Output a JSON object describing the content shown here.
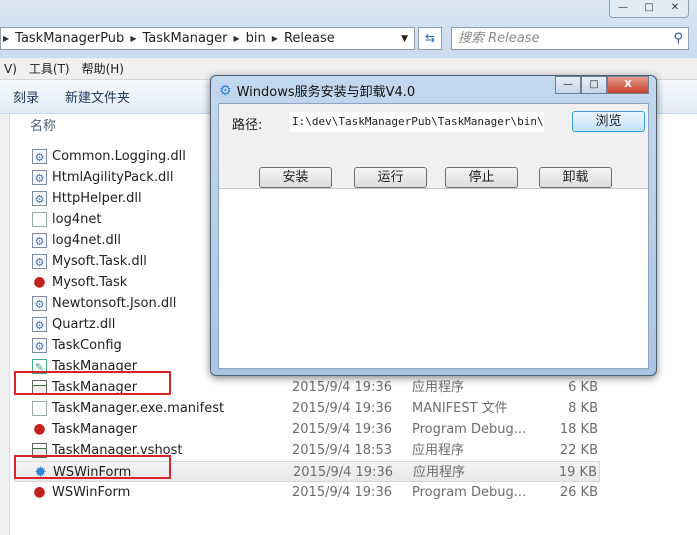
{
  "explorer": {
    "window_controls": [
      "—",
      "□",
      "✕"
    ],
    "breadcrumb": [
      "TaskManagerPub",
      "TaskManager",
      "bin",
      "Release"
    ],
    "search_placeholder": "搜索 Release",
    "menu": [
      "V)",
      "工具(T)",
      "帮助(H)"
    ],
    "toolbar": [
      "刻录",
      "新建文件夹"
    ],
    "column_name": "名称",
    "files": [
      {
        "name": "Common.Logging.dll",
        "icon": "dll"
      },
      {
        "name": "HtmlAgilityPack.dll",
        "icon": "dll"
      },
      {
        "name": "HttpHelper.dll",
        "icon": "dll"
      },
      {
        "name": "log4net",
        "icon": "doc"
      },
      {
        "name": "log4net.dll",
        "icon": "dll"
      },
      {
        "name": "Mysoft.Task.dll",
        "icon": "dll"
      },
      {
        "name": "Mysoft.Task",
        "icon": "pdb"
      },
      {
        "name": "Newtonsoft.Json.dll",
        "icon": "dll"
      },
      {
        "name": "Quartz.dll",
        "icon": "dll"
      },
      {
        "name": "TaskConfig",
        "icon": "dll"
      },
      {
        "name": "TaskManager",
        "icon": "cfg"
      },
      {
        "name": "TaskManager",
        "icon": "app",
        "date": "2015/9/4 19:36",
        "type": "应用程序",
        "size": "6 KB",
        "highlighted": true
      },
      {
        "name": "TaskManager.exe.manifest",
        "icon": "doc",
        "date": "2015/9/4 19:36",
        "type": "MANIFEST 文件",
        "size": "8 KB"
      },
      {
        "name": "TaskManager",
        "icon": "pdb",
        "date": "2015/9/4 19:36",
        "type": "Program Debug...",
        "size": "18 KB"
      },
      {
        "name": "TaskManager.vshost",
        "icon": "app",
        "date": "2015/9/4 18:53",
        "type": "应用程序",
        "size": "22 KB"
      },
      {
        "name": "WSWinForm",
        "icon": "gear",
        "date": "2015/9/4 19:36",
        "type": "应用程序",
        "size": "19 KB",
        "highlighted": true,
        "selected": true
      },
      {
        "name": "WSWinForm",
        "icon": "pdb",
        "date": "2015/9/4 19:36",
        "type": "Program Debug...",
        "size": "26 KB"
      }
    ]
  },
  "dialog": {
    "title": "Windows服务安装与卸载V4.0",
    "path_label": "路径:",
    "path_value": "I:\\dev\\TaskManagerPub\\TaskManager\\bin\\Release",
    "browse": "浏览",
    "buttons": [
      "安装",
      "运行",
      "停止",
      "卸载"
    ]
  },
  "colors": {
    "highlight": "#d9232a",
    "accent": "#3c9ad8"
  }
}
